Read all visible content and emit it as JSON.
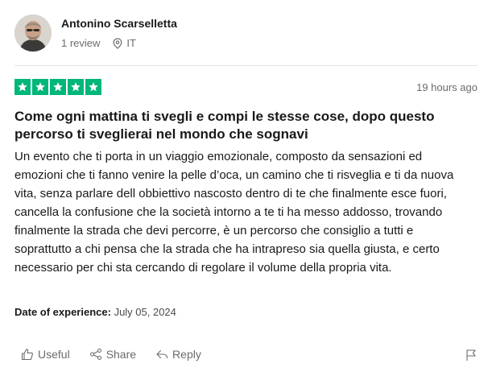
{
  "reviewer": {
    "name": "Antonino Scarselletta",
    "review_count": "1 review",
    "country": "IT"
  },
  "review": {
    "rating": 5,
    "max_rating": 5,
    "time_ago": "19 hours ago",
    "title": "Come ogni mattina ti svegli e compi le stesse cose, dopo questo percorso ti sveglierai nel mondo che sognavi",
    "body": "Un evento che ti porta in un viaggio emozionale, composto da sensazioni ed emozioni che ti fanno venire la pelle d’oca, un camino che ti risveglia e ti da nuova vita, senza parlare dell obbiettivo nascosto dentro di te che finalmente esce fuori, cancella la confusione che la società intorno a te ti ha messo addosso, trovando finalmente la strada che devi percorre, è un percorso che consiglio a tutti e soprattutto a chi pensa che la strada che ha intrapreso sia quella giusta, e certo necessario per chi sta cercando di regolare il volume della propria vita.",
    "experience_label": "Date of experience:",
    "experience_date": "July 05, 2024"
  },
  "actions": {
    "useful": "Useful",
    "share": "Share",
    "reply": "Reply"
  },
  "colors": {
    "star_green": "#00b67a",
    "muted_text": "#6b6b6b",
    "divider": "#e5e5dd"
  },
  "icons": [
    "location-pin-icon",
    "star-icon",
    "thumbs-up-icon",
    "share-icon",
    "reply-icon",
    "flag-icon"
  ]
}
